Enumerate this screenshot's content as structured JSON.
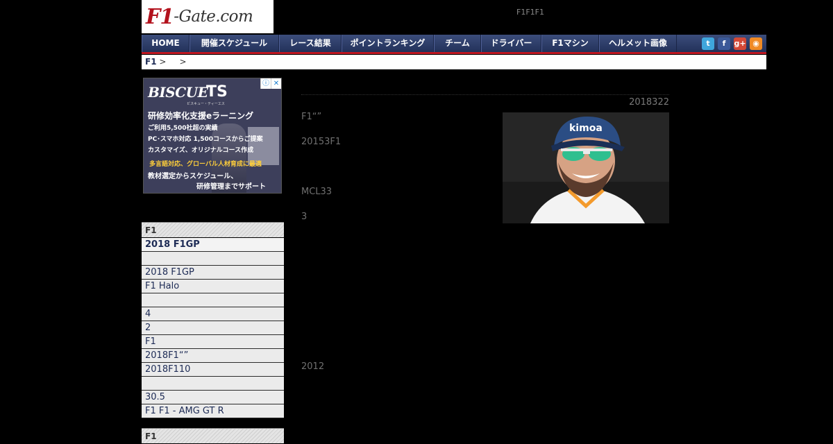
{
  "header": {
    "logo_f1": "F1",
    "logo_rest": "-Gate.com",
    "tagline": "F1F1F1"
  },
  "nav": {
    "items": [
      "HOME",
      "開催スケジュール",
      "レース結果",
      "ポイントランキング",
      "チーム",
      "ドライバー",
      "F1マシン",
      "ヘルメット画像"
    ],
    "social": [
      {
        "icon": "twitter-icon",
        "glyph": "t",
        "color": "#3fa6dc"
      },
      {
        "icon": "facebook-icon",
        "glyph": "f",
        "color": "#3b5998"
      },
      {
        "icon": "googleplus-icon",
        "glyph": "g+",
        "color": "#d34836"
      },
      {
        "icon": "rss-icon",
        "glyph": "◉",
        "color": "#f08a24"
      }
    ]
  },
  "breadcrumb": {
    "home": "F1",
    "sep1": " >",
    "sep2": ">"
  },
  "ad": {
    "brand": "BISCUE",
    "brand_ts": "TS",
    "brand_sub": "ビスキュー・ティーエス",
    "lines": [
      "研修効率化支援eラーニング",
      "ご利用5,500社超の実績",
      "PC･スマホ対応 1,500コースからご提案",
      "カスタマイズ、オリジナルコース作成",
      "多言語対応、グローバル人材育成に最適",
      "教材選定からスケジュール、",
      "研修管理までサポート"
    ],
    "info_icon": "ⓘ",
    "close_icon": "✕"
  },
  "sidebar": {
    "section1_title": "F1",
    "items": [
      {
        "label": "2018 F1GP",
        "bold": true
      },
      {
        "label": "",
        "bold": false
      },
      {
        "label": "2018 F1GP",
        "bold": false
      },
      {
        "label": "F1 Halo",
        "bold": false
      },
      {
        "label": "",
        "bold": false
      },
      {
        "label": " 4",
        "bold": false
      },
      {
        "label": " 2",
        "bold": false
      },
      {
        "label": "F1",
        "bold": false
      },
      {
        "label": "2018F1“”",
        "bold": false
      },
      {
        "label": "2018F110",
        "bold": false
      },
      {
        "label": "",
        "bold": false
      },
      {
        "label": " 30.5",
        "bold": false
      },
      {
        "label": "F1 F1 - AMG GT R",
        "bold": false
      }
    ],
    "section2_title": "F1"
  },
  "article": {
    "date": "2018322",
    "paragraphs": [
      "F1“”",
      "20153F1",
      "MCL33",
      "3",
      "2012"
    ],
    "photo_cap_text": "kimoa"
  }
}
